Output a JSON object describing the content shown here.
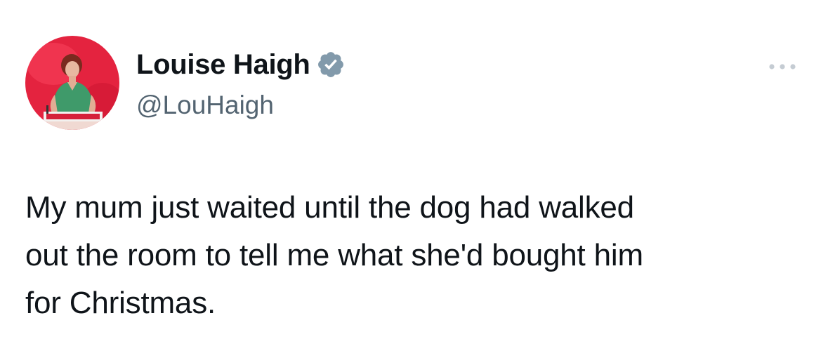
{
  "author": {
    "display_name": "Louise Haigh",
    "handle": "@LouHaigh",
    "verified": true,
    "avatar_icon": "profile-photo"
  },
  "tweet": {
    "text": "My mum just waited until the dog had walked\nout the room to tell me what she'd bought him\nfor Christmas."
  },
  "actions": {
    "more_icon": "more-horizontal-icon"
  },
  "colors": {
    "text_primary": "#0f1419",
    "text_secondary": "#536471",
    "verified_badge": "#829aab",
    "avatar_background": "#e4233f"
  }
}
